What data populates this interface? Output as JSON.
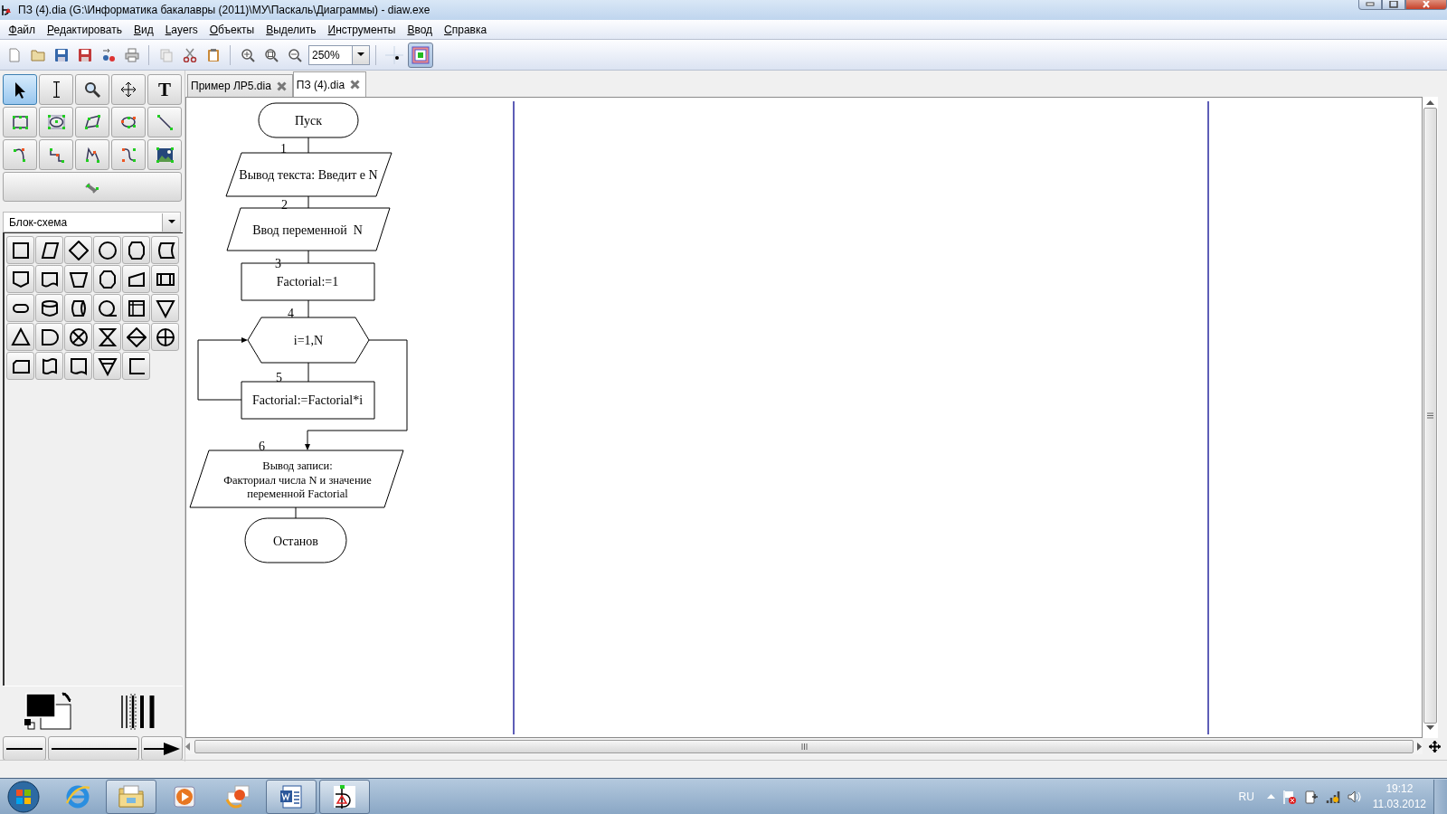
{
  "window": {
    "title": "ПЗ (4).dia (G:\\Информатика бакалавры (2011)\\МУ\\Паскаль\\Диаграммы) - diaw.exe"
  },
  "menu": [
    "Файл",
    "Редактировать",
    "Вид",
    "Layers",
    "Объекты",
    "Выделить",
    "Инструменты",
    "Ввод",
    "Справка"
  ],
  "toolbar": {
    "zoom": "250%",
    "toggles": [
      {
        "kind": "grid",
        "on": false
      },
      {
        "kind": "snap",
        "on": true
      }
    ]
  },
  "tools": [
    {
      "kind": "pointer",
      "selected": true
    },
    {
      "kind": "text-cursor",
      "selected": false
    },
    {
      "kind": "magnifier",
      "selected": false
    },
    {
      "kind": "move",
      "selected": false
    },
    {
      "kind": "text",
      "glyph": "T",
      "selected": false
    },
    {
      "kind": "rectangle",
      "selected": false
    },
    {
      "kind": "ellipse",
      "selected": false
    },
    {
      "kind": "polygon",
      "selected": false
    },
    {
      "kind": "blob",
      "selected": false
    },
    {
      "kind": "line",
      "selected": false
    },
    {
      "kind": "arc",
      "selected": false
    },
    {
      "kind": "zigzag",
      "selected": false
    },
    {
      "kind": "polyline",
      "selected": false
    },
    {
      "kind": "curve",
      "selected": false
    },
    {
      "kind": "image",
      "selected": false
    },
    {
      "kind": "connector",
      "selected": false
    }
  ],
  "sheet": {
    "value": "Блок-схема"
  },
  "tabs": [
    {
      "label": "Пример ЛР5.dia",
      "selected": false
    },
    {
      "label": "ПЗ (4).dia",
      "selected": true
    }
  ],
  "flowchart": {
    "nodes": [
      {
        "kind": "terminal",
        "lines": [
          "Пуск"
        ]
      },
      {
        "kind": "io",
        "number": "1",
        "lines": [
          "Вывод текста: Введит е N"
        ]
      },
      {
        "kind": "io",
        "number": "2",
        "lines": [
          "Ввод переменной  N"
        ]
      },
      {
        "kind": "process",
        "number": "3",
        "lines": [
          "Factorial:=1"
        ]
      },
      {
        "kind": "loop",
        "number": "4",
        "lines": [
          "i=1,N"
        ]
      },
      {
        "kind": "process",
        "number": "5",
        "lines": [
          "Factorial:=Factorial*i"
        ]
      },
      {
        "kind": "io",
        "number": "6",
        "lines": [
          "Вывод записи:",
          "Факториал числа N и значение",
          "переменной Factorial"
        ]
      },
      {
        "kind": "terminal",
        "lines": [
          "Останов"
        ]
      }
    ]
  },
  "taskbar": {
    "apps": [
      {
        "kind": "browser",
        "open": false
      },
      {
        "kind": "folder",
        "open": true
      },
      {
        "kind": "media",
        "open": false
      },
      {
        "kind": "photos",
        "open": false
      },
      {
        "kind": "word",
        "open": true
      },
      {
        "kind": "dia",
        "open": true
      }
    ],
    "tray": {
      "language": "RU",
      "time": "19:12",
      "date": "11.03.2012"
    }
  }
}
